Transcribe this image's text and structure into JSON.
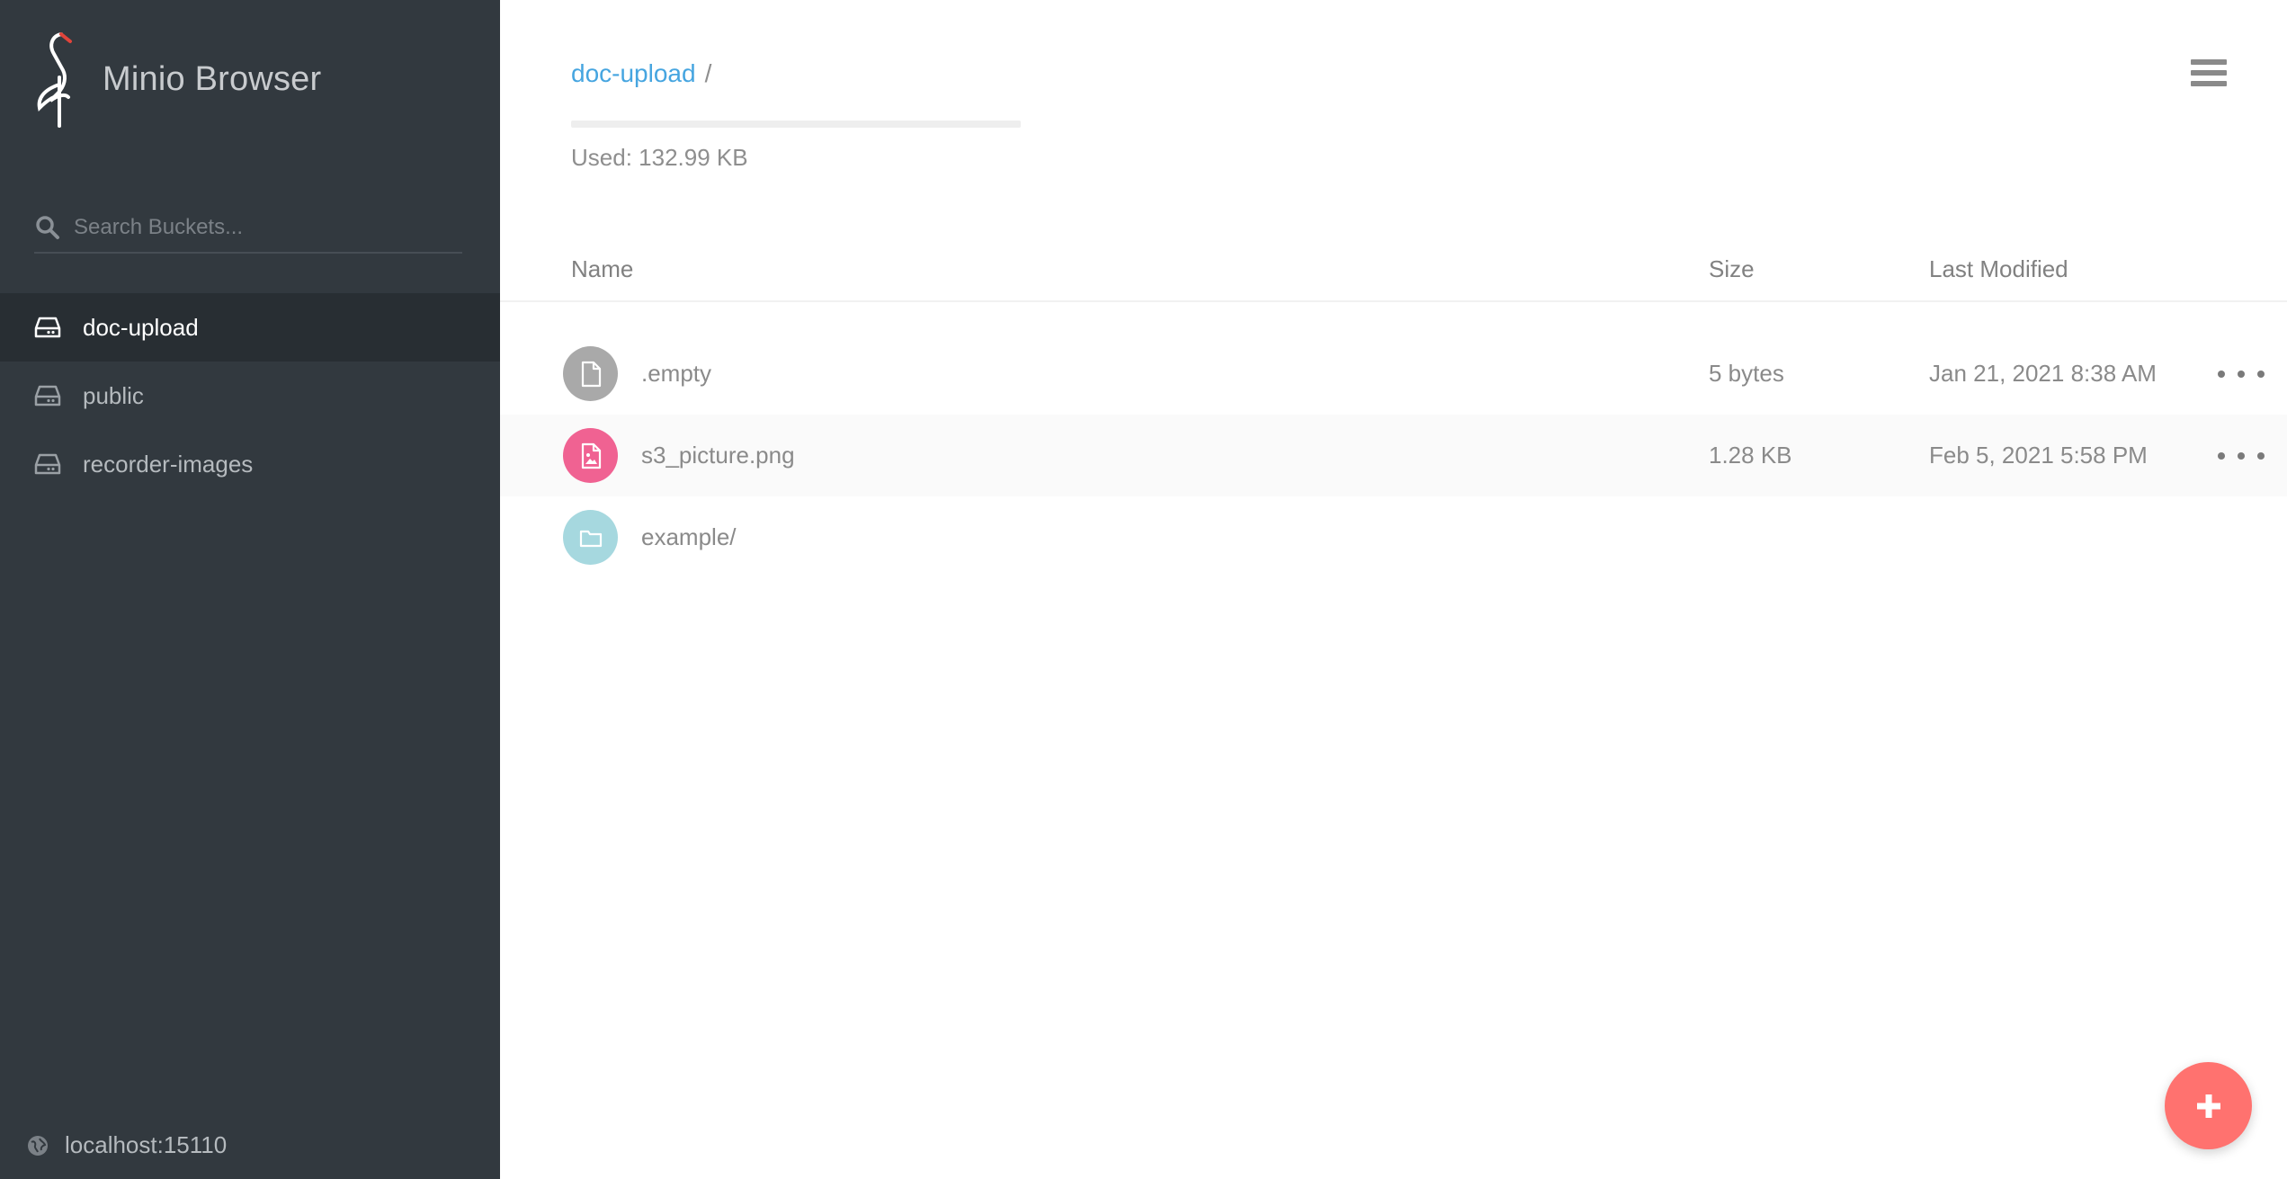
{
  "app": {
    "name": "Minio Browser"
  },
  "search": {
    "placeholder": "Search Buckets..."
  },
  "buckets": [
    {
      "label": "doc-upload",
      "active": true
    },
    {
      "label": "public",
      "active": false
    },
    {
      "label": "recorder-images",
      "active": false
    }
  ],
  "host": {
    "label": "localhost:15110"
  },
  "breadcrumb": {
    "bucket": "doc-upload",
    "separator": "/"
  },
  "usage": {
    "label": "Used: 132.99 KB",
    "fill_fraction": 0.0
  },
  "table": {
    "headers": {
      "name": "Name",
      "size": "Size",
      "modified": "Last Modified"
    },
    "rows": [
      {
        "icon": "file-icon",
        "name": ".empty",
        "size": "5 bytes",
        "modified": "Jan 21, 2021 8:38 AM",
        "icon_color": "#a9a9a9"
      },
      {
        "icon": "image-file-icon",
        "name": "s3_picture.png",
        "size": "1.28 KB",
        "modified": "Feb 5, 2021 5:58 PM",
        "icon_color": "#f06292"
      },
      {
        "icon": "folder-icon",
        "name": "example/",
        "size": "",
        "modified": "",
        "icon_color": "#a6d8df"
      }
    ]
  },
  "colors": {
    "sidebar_bg": "#32393f",
    "sidebar_active": "#282e33",
    "accent_link": "#46a5e0",
    "fab": "#ff726f"
  }
}
